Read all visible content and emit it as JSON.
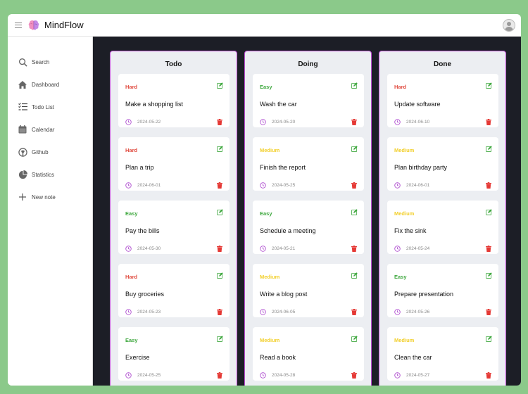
{
  "app": {
    "title": "MindFlow",
    "logo_icon": "brain-icon",
    "avatar_icon": "user-avatar-icon"
  },
  "colors": {
    "accent": "#c14fd6",
    "hard": "#e0483c",
    "easy": "#3fa83f",
    "medium": "#f2cf2a",
    "board_bg": "#1c1e26",
    "column_bg": "#eceef2"
  },
  "sidebar": {
    "items": [
      {
        "label": "Search",
        "icon": "search-icon"
      },
      {
        "label": "Dashboard",
        "icon": "home-icon"
      },
      {
        "label": "Todo List",
        "icon": "checklist-icon"
      },
      {
        "label": "Calendar",
        "icon": "calendar-icon"
      },
      {
        "label": "Github",
        "icon": "github-icon"
      },
      {
        "label": "Statistics",
        "icon": "pie-chart-icon"
      },
      {
        "label": "New note",
        "icon": "plus-icon"
      }
    ]
  },
  "board": {
    "columns": [
      {
        "title": "Todo",
        "cards": [
          {
            "difficulty": "Hard",
            "task": "Make a shopping list",
            "date": "2024-05-22"
          },
          {
            "difficulty": "Hard",
            "task": "Plan a trip",
            "date": "2024-06-01"
          },
          {
            "difficulty": "Easy",
            "task": "Pay the bills",
            "date": "2024-05-30"
          },
          {
            "difficulty": "Hard",
            "task": "Buy groceries",
            "date": "2024-05-23"
          },
          {
            "difficulty": "Easy",
            "task": "Exercise",
            "date": "2024-05-25"
          }
        ]
      },
      {
        "title": "Doing",
        "cards": [
          {
            "difficulty": "Easy",
            "task": "Wash the car",
            "date": "2024-05-20"
          },
          {
            "difficulty": "Medium",
            "task": "Finish the report",
            "date": "2024-05-25"
          },
          {
            "difficulty": "Easy",
            "task": "Schedule a meeting",
            "date": "2024-05-21"
          },
          {
            "difficulty": "Medium",
            "task": "Write a blog post",
            "date": "2024-06-05"
          },
          {
            "difficulty": "Medium",
            "task": "Read a book",
            "date": "2024-05-28"
          }
        ]
      },
      {
        "title": "Done",
        "cards": [
          {
            "difficulty": "Hard",
            "task": "Update software",
            "date": "2024-06-10"
          },
          {
            "difficulty": "Medium",
            "task": "Plan birthday party",
            "date": "2024-06-01"
          },
          {
            "difficulty": "Medium",
            "task": "Fix the sink",
            "date": "2024-05-24"
          },
          {
            "difficulty": "Easy",
            "task": "Prepare presentation",
            "date": "2024-05-26"
          },
          {
            "difficulty": "Medium",
            "task": "Clean the car",
            "date": "2024-05-27"
          }
        ]
      }
    ]
  }
}
